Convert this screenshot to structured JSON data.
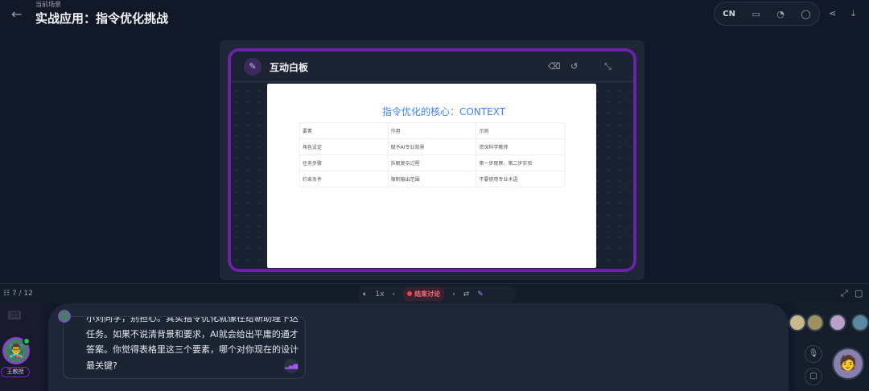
{
  "header": {
    "subtitle": "当前场景",
    "title": "实战应用：指令优化挑战",
    "lang": "CN"
  },
  "whiteboard": {
    "title": "互动白板",
    "slide_title": "指令优化的核心：CONTEXT",
    "table": [
      [
        "要素",
        "作用",
        "示例"
      ],
      [
        "角色设定",
        "赋予AI专业背景",
        "资深科学教师"
      ],
      [
        "任务步骤",
        "拆解复杂过程",
        "第一步观察，第二步实验"
      ],
      [
        "约束条件",
        "限制输出范围",
        "不要使用专业术语"
      ]
    ]
  },
  "controls": {
    "page": "7 / 12",
    "speed": "1x",
    "end_label": "结束讨论"
  },
  "teacher": {
    "name": "王教授"
  },
  "message": {
    "text": "小刘同学，别担心。其实指令优化就像在给新助理下达任务。如果不说清背景和要求，AI就会给出平庸的通才答案。你觉得表格里这三个要素，哪个对你现在的设计最关键?"
  },
  "colors": {
    "accent": "#7e22ce",
    "end": "#ef4444",
    "link": "#3b82f6"
  }
}
